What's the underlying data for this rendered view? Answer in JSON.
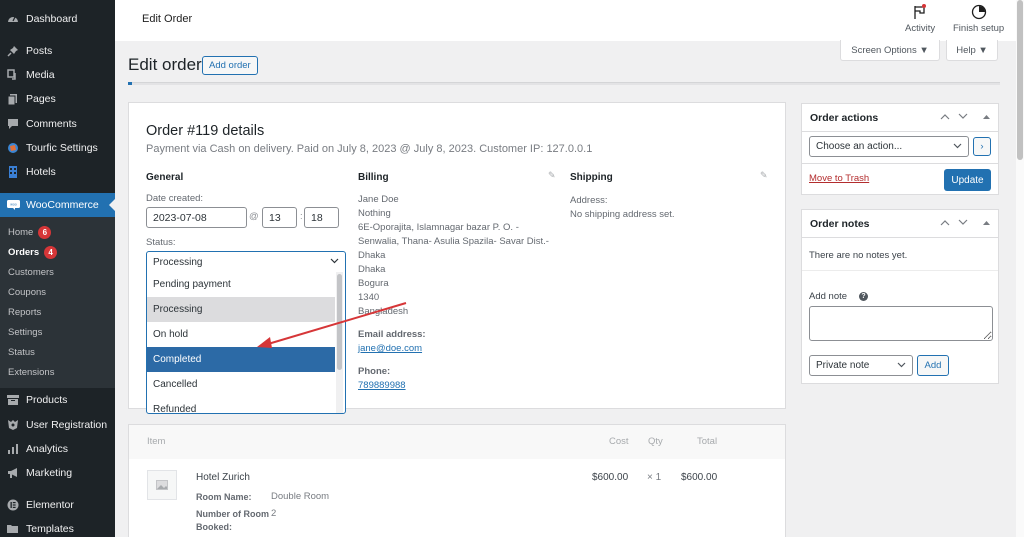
{
  "sidebar": {
    "items": [
      {
        "label": "Dashboard",
        "icon": "dashboard-icon"
      },
      {
        "label": "Posts",
        "icon": "pin-icon"
      },
      {
        "label": "Media",
        "icon": "media-icon"
      },
      {
        "label": "Pages",
        "icon": "pages-icon"
      },
      {
        "label": "Comments",
        "icon": "comment-icon"
      },
      {
        "label": "Tourfic Settings",
        "icon": "tourfic-icon"
      },
      {
        "label": "Hotels",
        "icon": "building-icon"
      },
      {
        "label": "WooCommerce",
        "icon": "woo-icon"
      },
      {
        "label": "Products",
        "icon": "archive-icon"
      },
      {
        "label": "User Registration",
        "icon": "user-registration-icon"
      },
      {
        "label": "Analytics",
        "icon": "bar-chart-icon"
      },
      {
        "label": "Marketing",
        "icon": "megaphone-icon"
      },
      {
        "label": "Elementor",
        "icon": "elementor-icon"
      },
      {
        "label": "Templates",
        "icon": "folder-icon"
      }
    ],
    "woo_submenu": [
      {
        "label": "Home",
        "badge": "6"
      },
      {
        "label": "Orders",
        "badge": "4"
      },
      {
        "label": "Customers"
      },
      {
        "label": "Coupons"
      },
      {
        "label": "Reports"
      },
      {
        "label": "Settings"
      },
      {
        "label": "Status"
      },
      {
        "label": "Extensions"
      }
    ]
  },
  "topbar": {
    "title": "Edit Order",
    "activity_label": "Activity",
    "finish_setup_label": "Finish setup"
  },
  "screen_options_label": "Screen Options ▼",
  "help_label": "Help ▼",
  "page": {
    "title": "Edit order",
    "add_order_label": "Add order"
  },
  "order": {
    "title": "Order #119 details",
    "meta": "Payment via Cash on delivery. Paid on July 8, 2023 @ July 8, 2023. Customer IP: 127.0.0.1",
    "general": {
      "heading": "General",
      "date_label": "Date created:",
      "date": "2023-07-08",
      "at": "@",
      "hour": "13",
      "colon": ":",
      "minute": "18",
      "status_label": "Status:",
      "status_selected": "Processing",
      "status_options": [
        "Pending payment",
        "Processing",
        "On hold",
        "Completed",
        "Cancelled",
        "Refunded"
      ],
      "status_hovered": "Processing",
      "status_highlighted": "Completed"
    },
    "billing": {
      "heading": "Billing",
      "address_lines": [
        "Jane Doe",
        "Nothing",
        "6E-Oporajita, Islamnagar bazar P. O. -",
        "Senwalia, Thana- Asulia Spazila- Savar Dist.-",
        "Dhaka",
        "Dhaka",
        "Bogura",
        "1340",
        "Bangladesh"
      ],
      "email_label": "Email address:",
      "email": "jane@doe.com",
      "phone_label": "Phone:",
      "phone": "789889988"
    },
    "shipping": {
      "heading": "Shipping",
      "address_label": "Address:",
      "address_value": "No shipping address set."
    }
  },
  "items": {
    "headers": {
      "item": "Item",
      "cost": "Cost",
      "qty": "Qty",
      "total": "Total"
    },
    "rows": [
      {
        "name": "Hotel Zurich",
        "meta": [
          {
            "key": "Room Name:",
            "value": "Double Room"
          },
          {
            "key": "Number of Room Booked:",
            "value": "2"
          }
        ],
        "cost": "$600.00",
        "qty": "× 1",
        "total": "$600.00"
      }
    ]
  },
  "order_actions": {
    "heading": "Order actions",
    "select_value": "Choose an action...",
    "go_label": "›",
    "trash_label": "Move to Trash",
    "update_label": "Update"
  },
  "order_notes": {
    "heading": "Order notes",
    "empty_text": "There are no notes yet.",
    "add_note_label": "Add note",
    "note_value": "",
    "note_type": "Private note",
    "add_label": "Add"
  },
  "colors": {
    "sidebar_bg": "#1d2327",
    "accent": "#2271b1",
    "badge": "#d63638",
    "annotation_arrow": "#d63638"
  }
}
